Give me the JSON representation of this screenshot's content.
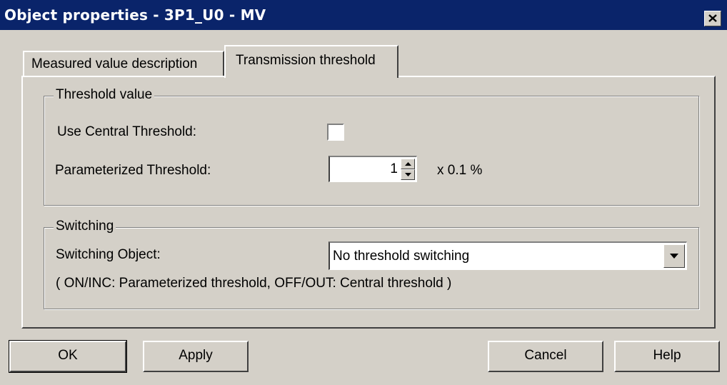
{
  "window": {
    "title": "Object properties - 3P1_U0 - MV",
    "close_icon": "close-icon"
  },
  "tabs": [
    {
      "label": "Measured value description",
      "active": false
    },
    {
      "label": "Transmission threshold",
      "active": true
    }
  ],
  "threshold_group": {
    "legend": "Threshold value",
    "use_central_label": "Use Central Threshold:",
    "use_central_checked": false,
    "parameterized_label": "Parameterized Threshold:",
    "parameterized_value": "1",
    "unit": "x 0.1 %"
  },
  "switching_group": {
    "legend": "Switching",
    "object_label": "Switching Object:",
    "object_value": "No threshold switching",
    "note": "( ON/INC: Parameterized threshold, OFF/OUT: Central threshold )"
  },
  "buttons": {
    "ok": "OK",
    "apply": "Apply",
    "cancel": "Cancel",
    "help": "Help"
  },
  "colors": {
    "titlebar": "#0a246a",
    "face": "#d4d0c8"
  }
}
